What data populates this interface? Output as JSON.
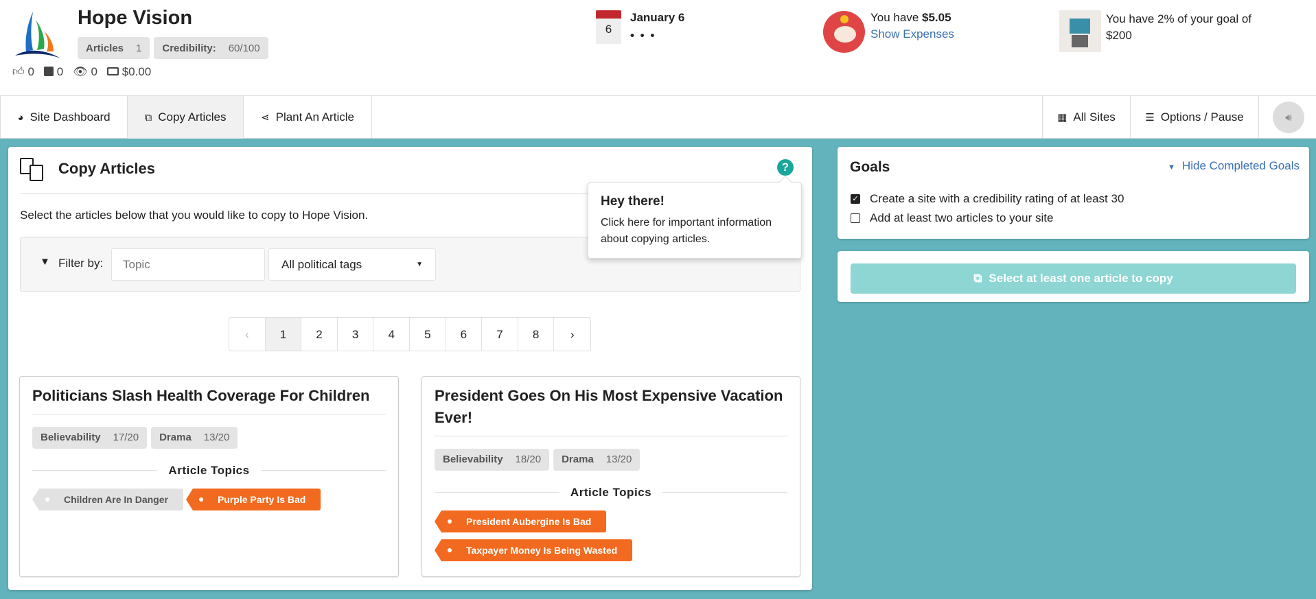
{
  "header": {
    "site_name": "Hope Vision",
    "articles_label": "Articles",
    "articles_value": "1",
    "credibility_label": "Credibility:",
    "credibility_value": "60/100",
    "stats": {
      "likes": "0",
      "shares": "0",
      "views": "0",
      "money": "$0.00"
    },
    "calendar": {
      "day": "6",
      "date": "January 6",
      "status": "• • •"
    },
    "wallet": {
      "prefix": "You have ",
      "amount": "$5.05",
      "link": "Show Expenses"
    },
    "goal": {
      "text": "You have 2% of your goal of $200",
      "progress_percent": 2
    }
  },
  "nav": {
    "tabs": [
      {
        "label": "Site Dashboard",
        "icon": "dashboard-icon"
      },
      {
        "label": "Copy Articles",
        "icon": "copy-icon",
        "active": true
      },
      {
        "label": "Plant An Article",
        "icon": "share-icon"
      }
    ],
    "all_sites": "All Sites",
    "options": "Options / Pause"
  },
  "main": {
    "title": "Copy Articles",
    "description": "Select the articles below that you would like to copy to Hope Vision.",
    "filter_label": "Filter by:",
    "topic_placeholder": "Topic",
    "political_select": "All political tags",
    "pagination": {
      "prev": "‹",
      "pages": [
        "1",
        "2",
        "3",
        "4",
        "5",
        "6",
        "7",
        "8"
      ],
      "current": "1",
      "next": "›"
    },
    "popover": {
      "title": "Hey there!",
      "body": "Click here for important information about copying articles."
    },
    "topics_heading": "Article Topics",
    "articles": [
      {
        "title": "Politicians Slash Health Coverage For Children",
        "believability_label": "Believability",
        "believability": "17/20",
        "drama_label": "Drama",
        "drama": "13/20",
        "topics": [
          {
            "label": "Children Are In Danger",
            "style": "neutral"
          },
          {
            "label": "Purple Party Is Bad",
            "style": "orange"
          }
        ]
      },
      {
        "title": "President Goes On His Most Expensive Vacation Ever!",
        "believability_label": "Believability",
        "believability": "18/20",
        "drama_label": "Drama",
        "drama": "13/20",
        "topics": [
          {
            "label": "President Aubergine Is Bad",
            "style": "orange"
          },
          {
            "label": "Taxpayer Money Is Being Wasted",
            "style": "orange"
          }
        ]
      }
    ]
  },
  "goals": {
    "title": "Goals",
    "toggle": "Hide Completed Goals",
    "items": [
      {
        "label": "Create a site with a credibility rating of at least 30",
        "done": true
      },
      {
        "label": "Add at least two articles to your site",
        "done": false
      }
    ]
  },
  "copy_button": "Select at least one article to copy",
  "colors": {
    "teal_bg": "#62b3bb",
    "accent": "#1aa69a",
    "orange": "#f26a1f",
    "link": "#3a6fb0",
    "button_disabled": "#8dd6d3"
  }
}
